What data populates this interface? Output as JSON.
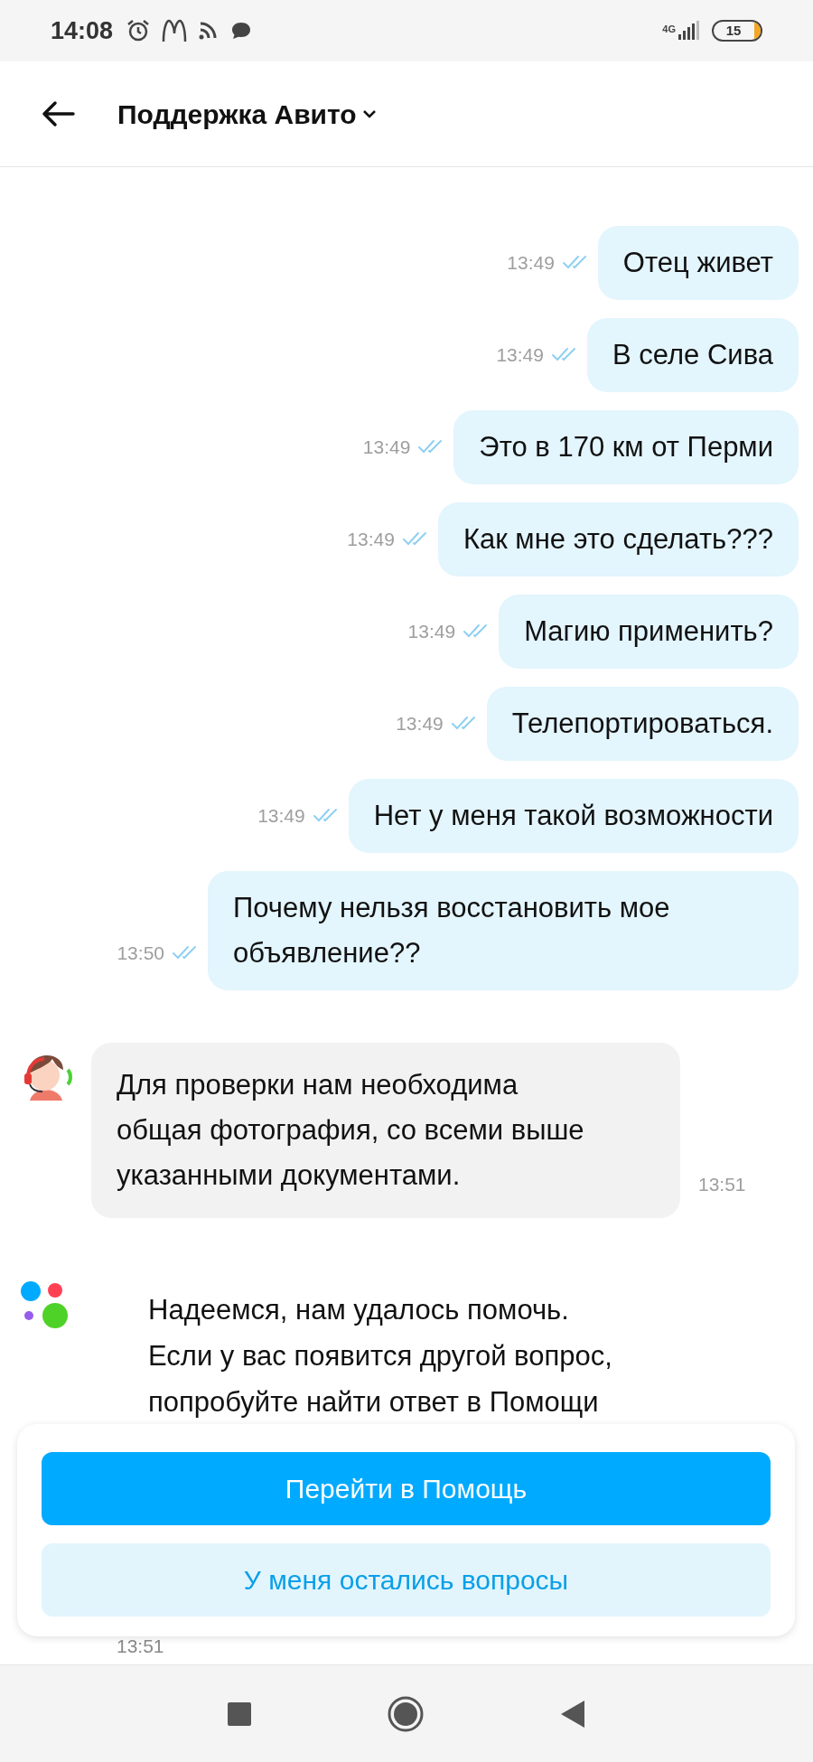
{
  "status_bar": {
    "time": "14:08",
    "network": "4G",
    "battery": "15"
  },
  "header": {
    "title": "Поддержка Авито"
  },
  "messages": [
    {
      "kind": "outgoing",
      "text": "Отец живет",
      "time": "13:49",
      "read": true
    },
    {
      "kind": "outgoing",
      "text": "В селе Сива",
      "time": "13:49",
      "read": true
    },
    {
      "kind": "outgoing",
      "text": "Это в 170 км от Перми",
      "time": "13:49",
      "read": true
    },
    {
      "kind": "outgoing",
      "text": "Как мне это сделать???",
      "time": "13:49",
      "read": true
    },
    {
      "kind": "outgoing",
      "text": "Магию применить?",
      "time": "13:49",
      "read": true
    },
    {
      "kind": "outgoing",
      "text": "Телепортироваться.",
      "time": "13:49",
      "read": true
    },
    {
      "kind": "outgoing",
      "text": "Нет у меня такой возможности",
      "time": "13:49",
      "read": true
    },
    {
      "kind": "outgoing",
      "text": "Почему нельзя восстановить мое объявление??",
      "time": "13:50",
      "read": true
    },
    {
      "kind": "incoming",
      "lines": [
        "Для проверки нам необходима",
        "общая фотография, со всеми выше",
        "указанными документами."
      ],
      "time": "13:51"
    },
    {
      "kind": "bot",
      "lines": [
        "Надеемся, нам удалось помочь.",
        "Если у вас появится другой вопрос,",
        "попробуйте найти ответ в Помощи"
      ],
      "time": "13:51"
    }
  ],
  "actions": [
    {
      "kind": "primary",
      "label": "Перейти в Помощь"
    },
    {
      "kind": "secondary",
      "label": "У меня остались вопросы"
    }
  ]
}
